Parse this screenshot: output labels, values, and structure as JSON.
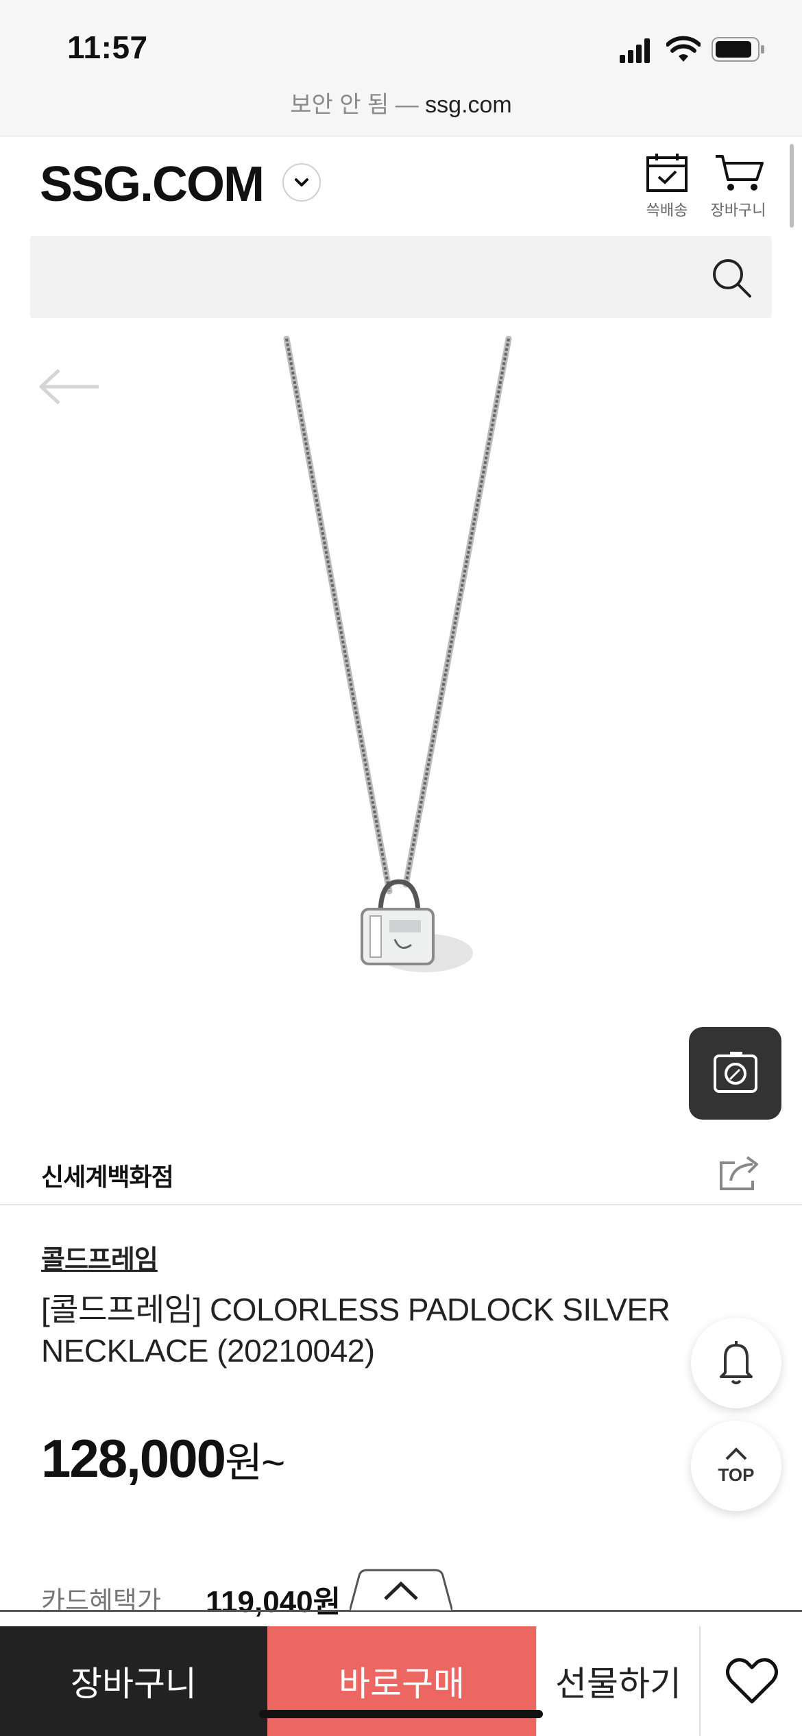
{
  "status_bar": {
    "time": "11:57"
  },
  "url_bar": {
    "security_text": "보안 안 됨",
    "separator": "—",
    "domain": "ssg.com"
  },
  "header": {
    "logo": "SSG.COM",
    "delivery_label": "쓱배송",
    "cart_label": "장바구니"
  },
  "search": {
    "placeholder": ""
  },
  "product": {
    "store": "신세계백화점",
    "brand": "콜드프레임",
    "title": "[콜드프레임] COLORLESS PADLOCK SILVER NECKLACE (20210042)",
    "price": "128,000",
    "price_unit": "원~",
    "card_label": "카드혜택가",
    "card_price": "119,040원"
  },
  "floating": {
    "top_label": "TOP"
  },
  "bottom_bar": {
    "cart": "장바구니",
    "buy": "바로구매",
    "gift": "선물하기"
  },
  "colors": {
    "buy_button": "#ec6662",
    "cart_button": "#222222"
  }
}
